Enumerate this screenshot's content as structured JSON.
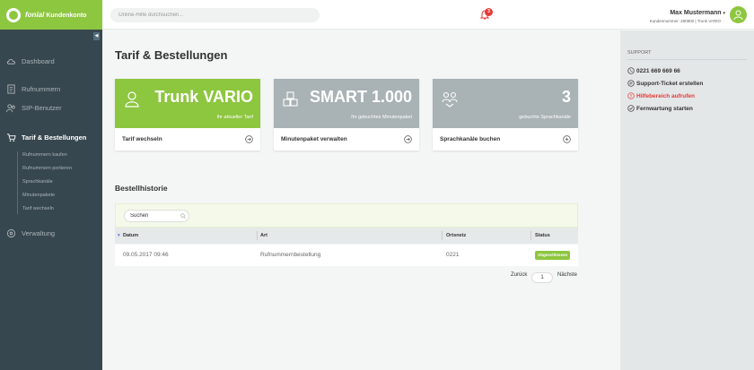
{
  "brand": {
    "name": "fonial",
    "product": "Kundenkonto"
  },
  "topbar": {
    "search_placeholder": "Online-Hilfe durchsuchen...",
    "notification_count": "3",
    "user_name": "Max Mustermann",
    "user_meta": "Kundennummer: 280800 | Trunk VARIO"
  },
  "sidebar": {
    "items": [
      {
        "label": "Dashboard",
        "icon": "cloud-icon"
      },
      {
        "label": "Rufnummern",
        "icon": "document-icon"
      },
      {
        "label": "SIP-Benutzer",
        "icon": "users-icon"
      },
      {
        "label": "Tarif & Bestellungen",
        "icon": "cart-icon"
      },
      {
        "label": "Verwaltung",
        "icon": "settings-icon"
      }
    ],
    "subitems": [
      "Rufnummern kaufen",
      "Rufnummern portieren",
      "Sprachkanäle",
      "Minutenpakete",
      "Tarif wechseln"
    ]
  },
  "main": {
    "title": "Tarif & Bestellungen",
    "cards": [
      {
        "big": "Trunk VARIO",
        "small": "Ihr aktueller Tarif",
        "action": "Tarif wechseln"
      },
      {
        "big": "SMART 1.000",
        "small": "Ihr gebuchtes Minutenpaket",
        "action": "Minutenpaket verwalten"
      },
      {
        "big": "3",
        "small": "gebuchte Sprachkanäle",
        "action": "Sprachkanäle buchen"
      }
    ],
    "history": {
      "title": "Bestellhistorie",
      "search_placeholder": "Suchen",
      "columns": [
        "Datum",
        "Art",
        "Ortsnetz",
        "Status"
      ],
      "rows": [
        {
          "date": "09.05.2017 09:46",
          "type": "Rufnummernbestellung",
          "area": "0221",
          "status": "Abgeschlossen"
        }
      ],
      "pager": {
        "prev": "Zurück",
        "page": "1",
        "next": "Nächste"
      }
    }
  },
  "support": {
    "title": "SUPPORT",
    "items": [
      {
        "label": "0221 669 669 66",
        "icon": "phone-icon"
      },
      {
        "label": "Support-Ticket erstellen",
        "icon": "ticket-icon"
      },
      {
        "label": "Hilfebereich aufrufen",
        "icon": "help-icon"
      },
      {
        "label": "Fernwartung starten",
        "icon": "remote-icon"
      }
    ]
  },
  "colors": {
    "accent": "#8dc63f",
    "sidebar": "#37474f",
    "danger": "#e53935"
  }
}
